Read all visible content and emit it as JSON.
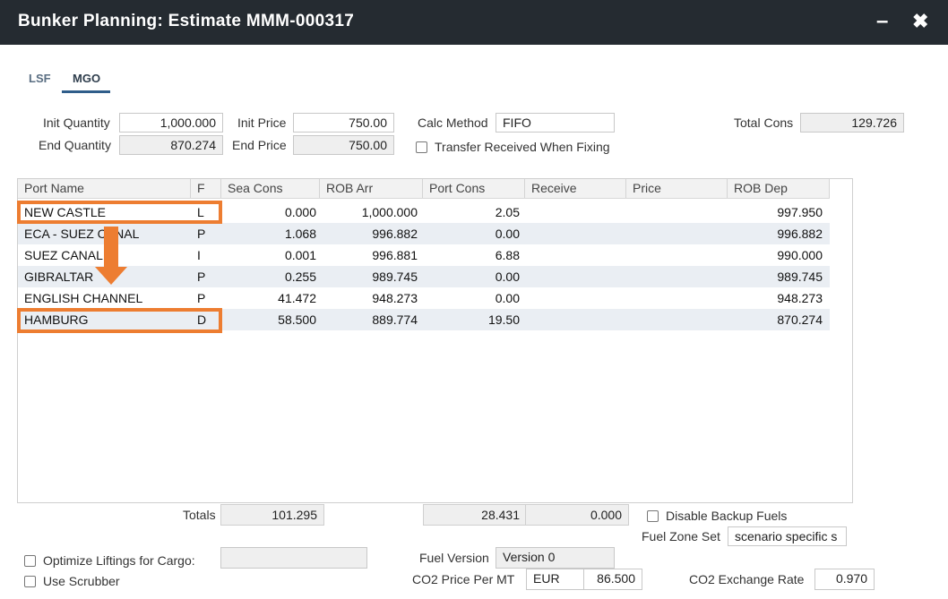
{
  "window": {
    "title": "Bunker Planning: Estimate MMM-000317",
    "minimize_glyph": "–",
    "close_glyph": "✖"
  },
  "tabs": [
    {
      "label": "LSF",
      "active": false
    },
    {
      "label": "MGO",
      "active": true
    }
  ],
  "form": {
    "init_quantity_label": "Init Quantity",
    "init_quantity": "1,000.000",
    "end_quantity_label": "End Quantity",
    "end_quantity": "870.274",
    "init_price_label": "Init Price",
    "init_price": "750.00",
    "end_price_label": "End Price",
    "end_price": "750.00",
    "calc_method_label": "Calc Method",
    "calc_method": "FIFO",
    "transfer_label": "Transfer Received When Fixing",
    "total_cons_label": "Total Cons",
    "total_cons": "129.726"
  },
  "grid": {
    "columns": [
      "Port Name",
      "F",
      "Sea Cons",
      "ROB Arr",
      "Port Cons",
      "Receive",
      "Price",
      "ROB Dep"
    ],
    "rows": [
      {
        "port": "NEW CASTLE",
        "f": "L",
        "sea_cons": "0.000",
        "rob_arr": "1,000.000",
        "port_cons": "2.05",
        "receive": "",
        "price": "",
        "rob_dep": "997.950"
      },
      {
        "port": "ECA - SUEZ CANAL",
        "f": "P",
        "sea_cons": "1.068",
        "rob_arr": "996.882",
        "port_cons": "0.00",
        "receive": "",
        "price": "",
        "rob_dep": "996.882"
      },
      {
        "port": "SUEZ CANAL",
        "f": "I",
        "sea_cons": "0.001",
        "rob_arr": "996.881",
        "port_cons": "6.88",
        "receive": "",
        "price": "",
        "rob_dep": "990.000"
      },
      {
        "port": "GIBRALTAR",
        "f": "P",
        "sea_cons": "0.255",
        "rob_arr": "989.745",
        "port_cons": "0.00",
        "receive": "",
        "price": "",
        "rob_dep": "989.745"
      },
      {
        "port": "ENGLISH CHANNEL",
        "f": "P",
        "sea_cons": "41.472",
        "rob_arr": "948.273",
        "port_cons": "0.00",
        "receive": "",
        "price": "",
        "rob_dep": "948.273"
      },
      {
        "port": "HAMBURG",
        "f": "D",
        "sea_cons": "58.500",
        "rob_arr": "889.774",
        "port_cons": "19.50",
        "receive": "",
        "price": "",
        "rob_dep": "870.274"
      }
    ]
  },
  "totals": {
    "label": "Totals",
    "sea_cons": "101.295",
    "port_cons": "28.431",
    "receive": "0.000"
  },
  "options": {
    "disable_backup_label": "Disable Backup Fuels",
    "fuel_zone_set_label": "Fuel Zone Set",
    "fuel_zone_set": "scenario specific s",
    "optimize_label": "Optimize Liftings for Cargo:",
    "optimize_value": "",
    "use_scrubber_label": "Use Scrubber",
    "fuel_version_label": "Fuel Version",
    "fuel_version": "Version 0",
    "co2_price_label": "CO2 Price Per MT",
    "co2_currency": "EUR",
    "co2_price": "86.500",
    "co2_exchange_label": "CO2 Exchange Rate",
    "co2_exchange": "0.970"
  },
  "highlight_color": "#ed7d31"
}
